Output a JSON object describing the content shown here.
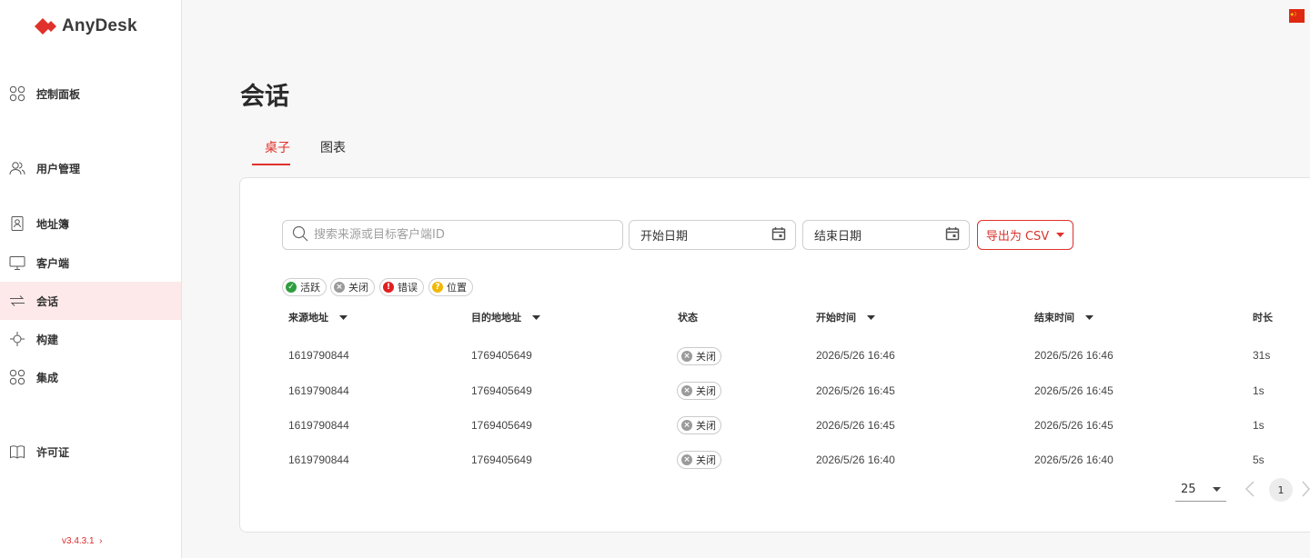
{
  "app": {
    "name": "AnyDesk",
    "version": "v3.4.3.1",
    "language_flag": "china-flag",
    "accent_color": "#e0312b"
  },
  "sidebar": {
    "items": [
      {
        "label": "控制面板",
        "icon": "dashboard-icon"
      },
      {
        "label": "用户管理",
        "icon": "users-icon"
      },
      {
        "label": "地址簿",
        "icon": "address-book-icon"
      },
      {
        "label": "客户端",
        "icon": "monitor-icon"
      },
      {
        "label": "会话",
        "icon": "sessions-icon",
        "active": true
      },
      {
        "label": "构建",
        "icon": "build-icon"
      },
      {
        "label": "集成",
        "icon": "integrations-icon"
      },
      {
        "label": "许可证",
        "icon": "license-icon"
      }
    ]
  },
  "page": {
    "title": "会话",
    "tabs": [
      {
        "label": "桌子",
        "active": true
      },
      {
        "label": "图表",
        "active": false
      }
    ]
  },
  "filters": {
    "search_placeholder": "搜索来源或目标客户端ID",
    "start_date": "开始日期",
    "end_date": "结束日期",
    "export_label": "导出为 CSV"
  },
  "legend": [
    {
      "label": "活跃",
      "color": "#2e9e3f",
      "icon": "check-icon"
    },
    {
      "label": "关闭",
      "color": "#9a9a9a",
      "icon": "x-circle-icon"
    },
    {
      "label": "错误",
      "color": "#e02020",
      "icon": "error-icon"
    },
    {
      "label": "位置",
      "color": "#f2b705",
      "icon": "question-icon"
    }
  ],
  "table": {
    "columns": [
      "来源地址",
      "目的地地址",
      "状态",
      "开始时间",
      "结束时间",
      "时长"
    ],
    "rows": [
      {
        "source": "1619790844",
        "destination": "1769405649",
        "status": "关闭",
        "start": "2026/5/26 16:46",
        "end": "2026/5/26 16:46",
        "duration": "31s"
      },
      {
        "source": "1619790844",
        "destination": "1769405649",
        "status": "关闭",
        "start": "2026/5/26 16:45",
        "end": "2026/5/26 16:45",
        "duration": "1s"
      },
      {
        "source": "1619790844",
        "destination": "1769405649",
        "status": "关闭",
        "start": "2026/5/26 16:45",
        "end": "2026/5/26 16:45",
        "duration": "1s"
      },
      {
        "source": "1619790844",
        "destination": "1769405649",
        "status": "关闭",
        "start": "2026/5/26 16:40",
        "end": "2026/5/26 16:40",
        "duration": "5s"
      }
    ]
  },
  "pagination": {
    "page_size": "25",
    "current_page": "1"
  }
}
